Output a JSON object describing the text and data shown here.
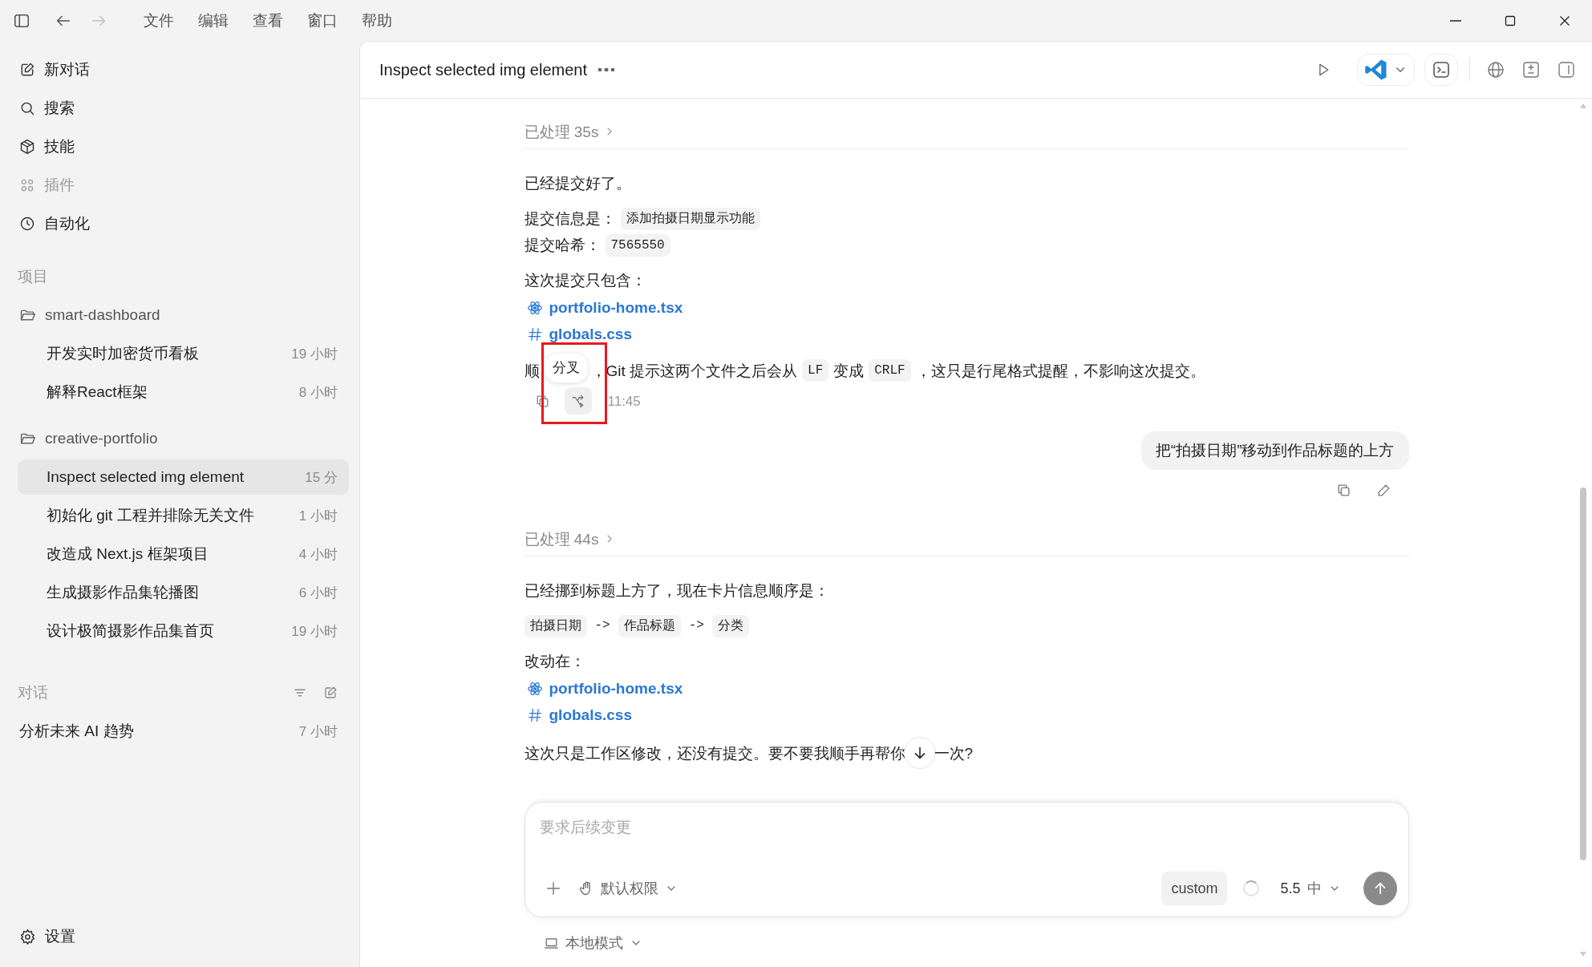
{
  "title_bar": {
    "navigation": [
      {
        "disabled": false
      },
      {
        "disabled": true
      }
    ],
    "menus": [
      "文件",
      "编辑",
      "查看",
      "窗口",
      "帮助"
    ]
  },
  "sidebar": {
    "nav": [
      {
        "label": "新对话",
        "disabled": false
      },
      {
        "label": "搜索",
        "disabled": false
      },
      {
        "label": "技能",
        "disabled": false
      },
      {
        "label": "插件",
        "disabled": true
      },
      {
        "label": "自动化",
        "disabled": false
      }
    ],
    "projects_title": "项目",
    "projects": [
      {
        "name": "smart-dashboard",
        "chats": [
          {
            "title": "开发实时加密货币看板",
            "time": "19 小时",
            "selected": false
          },
          {
            "title": "解释React框架",
            "time": "8 小时",
            "selected": false
          }
        ]
      },
      {
        "name": "creative-portfolio",
        "chats": [
          {
            "title": "Inspect selected img element",
            "time": "15 分",
            "selected": true
          },
          {
            "title": "初始化 git 工程并排除无关文件",
            "time": "1 小时",
            "selected": false
          },
          {
            "title": "改造成 Next.js 框架项目",
            "time": "4 小时",
            "selected": false
          },
          {
            "title": "生成摄影作品集轮播图",
            "time": "6 小时",
            "selected": false
          },
          {
            "title": "设计极简摄影作品集首页",
            "time": "19 小时",
            "selected": false
          }
        ]
      }
    ],
    "conversations": {
      "title": "对话",
      "chats": [
        {
          "title": "分析未来 AI 趋势",
          "time": "7 小时",
          "selected": false
        }
      ]
    },
    "settings": "设置"
  },
  "header": {
    "title": "Inspect selected img element"
  },
  "messages": [
    {
      "kind": "assistant",
      "processed": "已处理 35s",
      "highlighted": true,
      "time": "11:45",
      "blocks": [
        {
          "kind": "para",
          "lines": [
            [
              {
                "kind": "plain",
                "text": "已经提交好了。"
              }
            ]
          ]
        },
        {
          "kind": "para",
          "lines": [
            [
              {
                "kind": "plain",
                "text": "提交信息是："
              },
              {
                "kind": "code",
                "text": "添加拍摄日期显示功能"
              }
            ],
            [
              {
                "kind": "plain",
                "text": "提交哈希："
              },
              {
                "kind": "code",
                "text": "7565550"
              }
            ]
          ]
        },
        {
          "kind": "para",
          "lines": [
            [
              {
                "kind": "plain",
                "text": "这次提交只包含："
              }
            ]
          ]
        },
        {
          "kind": "files",
          "files": [
            {
              "kind": "tsx",
              "name": "portfolio-home.tsx"
            },
            {
              "kind": "css",
              "name": "globals.css"
            }
          ]
        },
        {
          "kind": "para",
          "lines": [
            [
              {
                "kind": "plain",
                "text": "顺"
              },
              {
                "kind": "tooltip",
                "text": "分叉"
              },
              {
                "kind": "plain",
                "text": "，Git 提示这两个文件之后会从"
              },
              {
                "kind": "code",
                "text": "LF"
              },
              {
                "kind": "plain",
                "text": "变成"
              },
              {
                "kind": "code",
                "text": "CRLF"
              },
              {
                "kind": "plain",
                "text": "，这只是行尾格式提醒，不影响这次提交。"
              }
            ]
          ]
        }
      ]
    },
    {
      "kind": "user",
      "text": "把“拍摄日期”移动到作品标题的上方"
    },
    {
      "kind": "assistant",
      "processed": "已处理 44s",
      "blocks": [
        {
          "kind": "para",
          "lines": [
            [
              {
                "kind": "plain",
                "text": "已经挪到标题上方了，现在卡片信息顺序是："
              }
            ]
          ]
        },
        {
          "kind": "para",
          "lines": [
            [
              {
                "kind": "code",
                "text": "拍摄日期"
              },
              {
                "kind": "mono",
                "text": "->"
              },
              {
                "kind": "code",
                "text": "作品标题"
              },
              {
                "kind": "mono",
                "text": "->"
              },
              {
                "kind": "code",
                "text": "分类"
              }
            ]
          ]
        },
        {
          "kind": "para",
          "lines": [
            [
              {
                "kind": "plain",
                "text": "改动在："
              }
            ]
          ]
        },
        {
          "kind": "files",
          "files": [
            {
              "kind": "tsx",
              "name": "portfolio-home.tsx"
            },
            {
              "kind": "css",
              "name": "globals.css"
            }
          ]
        },
        {
          "kind": "para",
          "lines": [
            [
              {
                "kind": "plain",
                "text": "这次只是工作区修改，还没有提交。要不要我顺手再帮你"
              },
              {
                "kind": "scroll_button"
              },
              {
                "kind": "plain",
                "text": "一次?"
              }
            ]
          ]
        }
      ]
    }
  ],
  "composer": {
    "placeholder": "要求后续变更",
    "permission": "默认权限",
    "model_tag": "custom",
    "model": "5.5",
    "effort": "中",
    "mode": "本地模式"
  }
}
